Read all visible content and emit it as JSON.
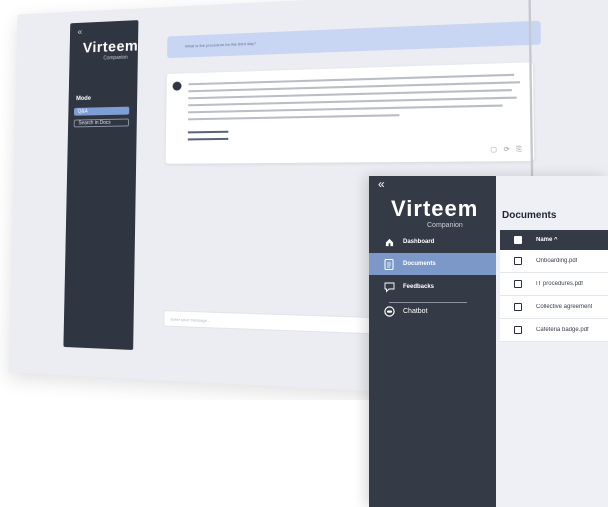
{
  "back_window": {
    "logo": "Virteem",
    "logo_sub": "Companion",
    "collapse_glyph": "«",
    "mode_title": "Mode",
    "mode_options": [
      "Q&A",
      "Search in Docs"
    ],
    "query_text": "What is the procedure for the third day?",
    "input_placeholder": "Enter your message...",
    "answer_links": [
      "[Document.pdf, Page]",
      "[Document.pdf, Page]"
    ],
    "answer_actions": "▢ ⟳ ⎘"
  },
  "front_window": {
    "collapse_glyph": "«",
    "logo": "Virteem",
    "logo_sub": "Companion",
    "nav": [
      {
        "label": "Dashboard",
        "icon": "home-icon"
      },
      {
        "label": "Documents",
        "icon": "document-icon"
      },
      {
        "label": "Feedbacks",
        "icon": "feedback-icon"
      },
      {
        "label": "Chatbot",
        "icon": "chatbot-icon"
      }
    ],
    "page_title": "Documents",
    "table": {
      "header": {
        "name": "Name ^"
      },
      "rows": [
        {
          "name": "Onboarding.pdf"
        },
        {
          "name": "IT procedures.pdf"
        },
        {
          "name": "Collective agreement"
        },
        {
          "name": "Cafeteria badge.pdf"
        }
      ]
    }
  },
  "colors": {
    "sidebar": "#343b47",
    "active_nav": "#7c98c8",
    "query_bubble": "#c9d6f3"
  }
}
